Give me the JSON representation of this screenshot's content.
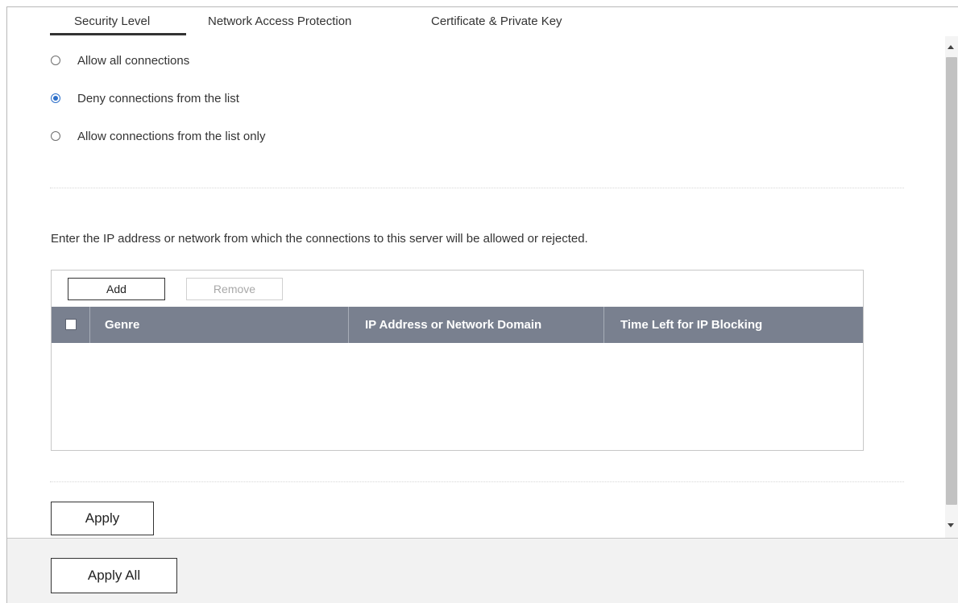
{
  "tabs": [
    {
      "label": "Security Level",
      "active": true
    },
    {
      "label": "Network Access Protection",
      "active": false
    },
    {
      "label": "Certificate & Private Key",
      "active": false
    }
  ],
  "security_options": [
    {
      "label": "Allow all connections",
      "selected": false
    },
    {
      "label": "Deny connections from the list",
      "selected": true
    },
    {
      "label": "Allow connections from the list only",
      "selected": false
    }
  ],
  "list_description": "Enter the IP address or network from which the connections to this server will be allowed or rejected.",
  "list_toolbar": {
    "add_label": "Add",
    "remove_label": "Remove",
    "remove_enabled": false
  },
  "table": {
    "columns": [
      "Genre",
      "IP Address or Network Domain",
      "Time Left for IP Blocking"
    ],
    "rows": []
  },
  "apply_label": "Apply",
  "footer": {
    "apply_all_label": "Apply All"
  },
  "colors": {
    "header_bg": "#79808f",
    "radio_selected": "#2c6fc9",
    "footer_bg": "#f2f2f2"
  }
}
